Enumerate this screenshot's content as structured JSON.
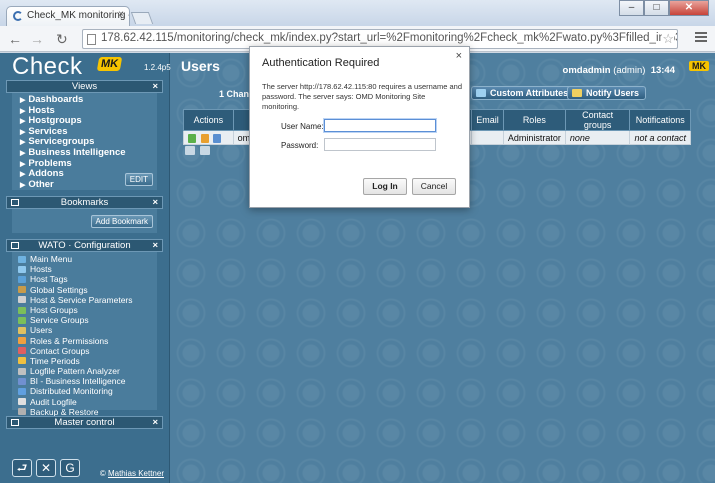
{
  "browser": {
    "tab_title": "Check_MK monitoring - L",
    "tab_close": "×",
    "window_buttons": [
      "–",
      "□",
      "✕"
    ],
    "url": "178.62.42.115/monitoring/check_mk/index.py?start_url=%2Fmonitoring%2Fcheck_mk%2Fwato.py%3Ffilled_in%3Duser%26_transid%",
    "nav": {
      "back": "←",
      "forward": "→",
      "reload": "↻",
      "star": "☆"
    }
  },
  "sidebar": {
    "logo_text": "Check",
    "logo_badge": "MK",
    "version": "1.2.4p5",
    "views": {
      "title": "Views",
      "close": "×",
      "items": [
        "Dashboards",
        "Hosts",
        "Hostgroups",
        "Services",
        "Servicegroups",
        "Business Intelligence",
        "Problems",
        "Addons",
        "Other"
      ],
      "edit_label": "EDIT"
    },
    "bookmarks": {
      "title": "Bookmarks",
      "close": "×",
      "add_label": "Add Bookmark"
    },
    "wato": {
      "title": "WATO · Configuration",
      "close": "×",
      "items": [
        "Main Menu",
        "Hosts",
        "Host Tags",
        "Global Settings",
        "Host & Service Parameters",
        "Host Groups",
        "Service Groups",
        "Users",
        "Roles & Permissions",
        "Contact Groups",
        "Time Periods",
        "Logfile Pattern Analyzer",
        "BI - Business Intelligence",
        "Distributed Monitoring",
        "Audit Logfile",
        "Backup & Restore"
      ],
      "icon_colors": [
        "#6fb2e0",
        "#8fc8ee",
        "#5aa0d8",
        "#c79b4a",
        "#d0d0d0",
        "#7bbf5a",
        "#7bbf5a",
        "#e0c060",
        "#f0a040",
        "#e06060",
        "#f0c040",
        "#c0c0c0",
        "#7090d0",
        "#60a0e0",
        "#e0e0e0",
        "#b0b0b0"
      ]
    },
    "master_control": {
      "title": "Master control",
      "close": "×"
    },
    "footer": {
      "copyright": "©",
      "author": "Mathias Kettner"
    },
    "bottom_icons": [
      "⮐",
      "✕",
      "G"
    ]
  },
  "main": {
    "title": "Users",
    "user": "omdadmin",
    "role": "(admin)",
    "time": "13:44",
    "badge": "MK",
    "changes": "1 Change",
    "buttons": {
      "custom_attributes": "Custom Attributes",
      "notify_users": "Notify Users"
    },
    "table": {
      "headers": [
        "Actions",
        "",
        "",
        "Email",
        "Roles",
        "Contact groups",
        "Notifications"
      ],
      "rows": [
        {
          "name": "omdi",
          "email": "",
          "roles": "Administrator",
          "contact_groups": "none",
          "notifications": "not a contact"
        }
      ]
    }
  },
  "dialog": {
    "title": "Authentication Required",
    "close": "×",
    "message": "The server http://178.62.42.115:80 requires a username and password. The server says: OMD Monitoring Site monitoring.",
    "username_label": "User Name:",
    "password_label": "Password:",
    "username_value": "",
    "password_value": "",
    "login_label": "Log In",
    "cancel_label": "Cancel"
  },
  "colors": {
    "accent_yellow": "#f7c400",
    "page_bg": "#4f7f9f",
    "sidebar_bg": "#3c6e8e"
  }
}
